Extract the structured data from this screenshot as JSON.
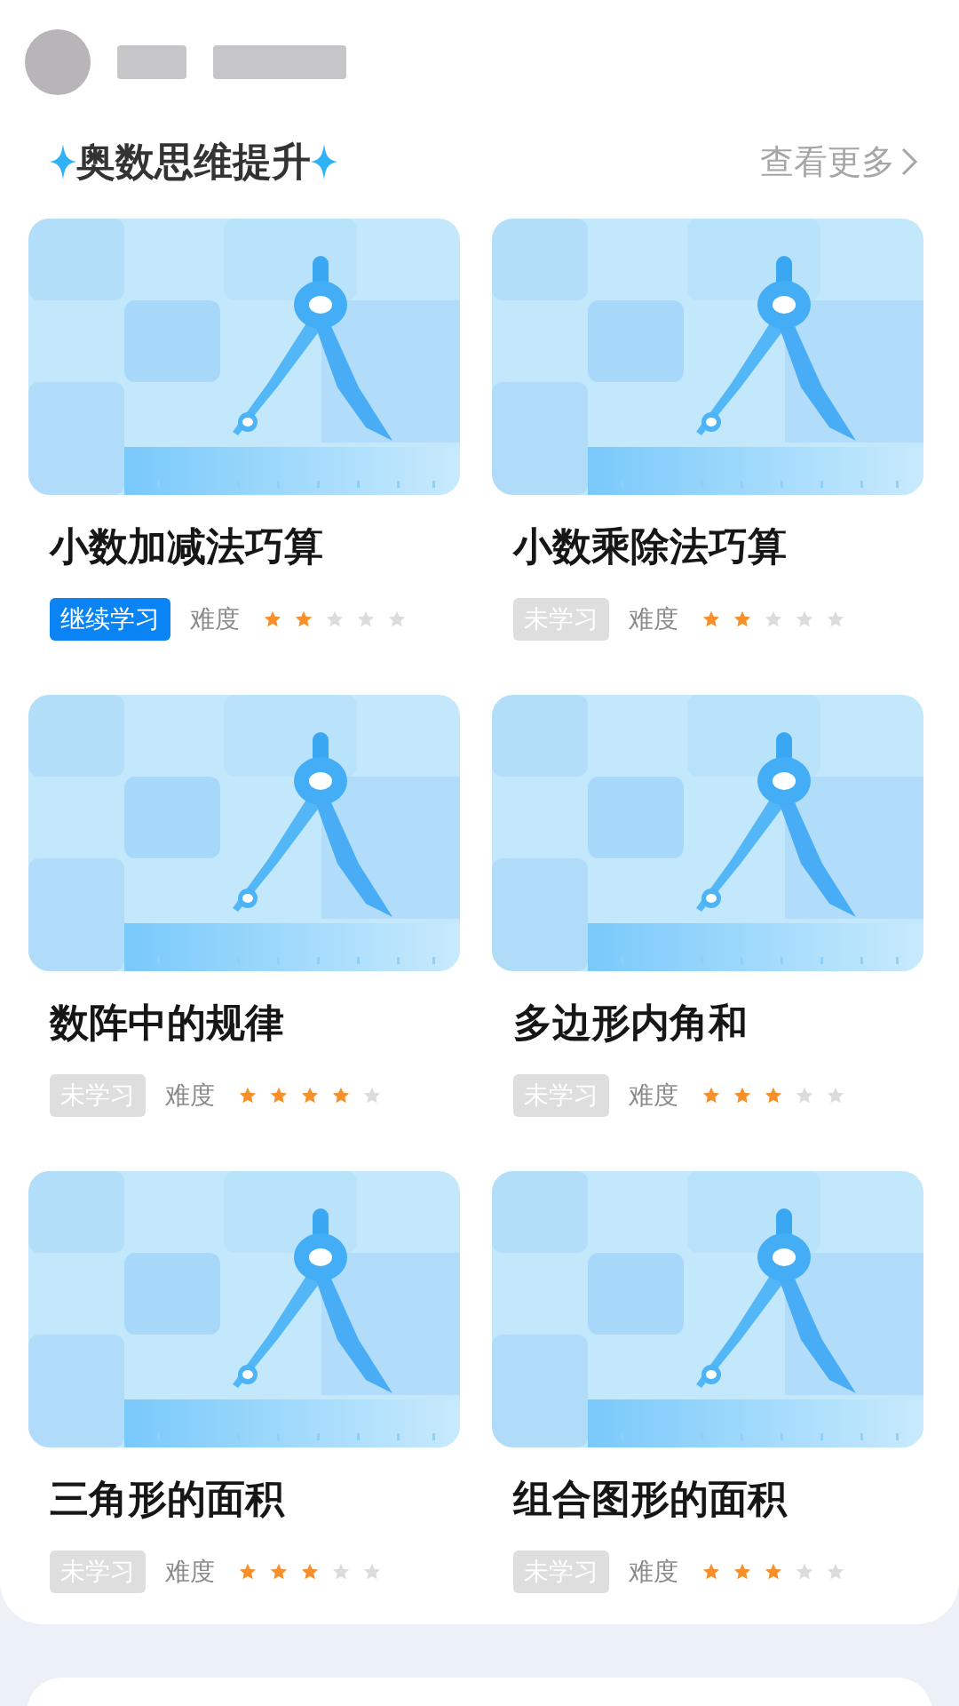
{
  "section": {
    "title": "奥数思维提升",
    "more_link": "查看更多"
  },
  "courses": [
    {
      "title": "小数加减法巧算",
      "status": {
        "kind": "continue",
        "label": "继续学习"
      },
      "difficulty_label": "难度",
      "stars": 2
    },
    {
      "title": "小数乘除法巧算",
      "status": {
        "kind": "unstarted",
        "label": "未学习"
      },
      "difficulty_label": "难度",
      "stars": 2
    },
    {
      "title": "数阵中的规律",
      "status": {
        "kind": "unstarted",
        "label": "未学习"
      },
      "difficulty_label": "难度",
      "stars": 4
    },
    {
      "title": "多边形内角和",
      "status": {
        "kind": "unstarted",
        "label": "未学习"
      },
      "difficulty_label": "难度",
      "stars": 3
    },
    {
      "title": "三角形的面积",
      "status": {
        "kind": "unstarted",
        "label": "未学习"
      },
      "difficulty_label": "难度",
      "stars": 3
    },
    {
      "title": "组合图形的面积",
      "status": {
        "kind": "unstarted",
        "label": "未学习"
      },
      "difficulty_label": "难度",
      "stars": 3
    }
  ]
}
